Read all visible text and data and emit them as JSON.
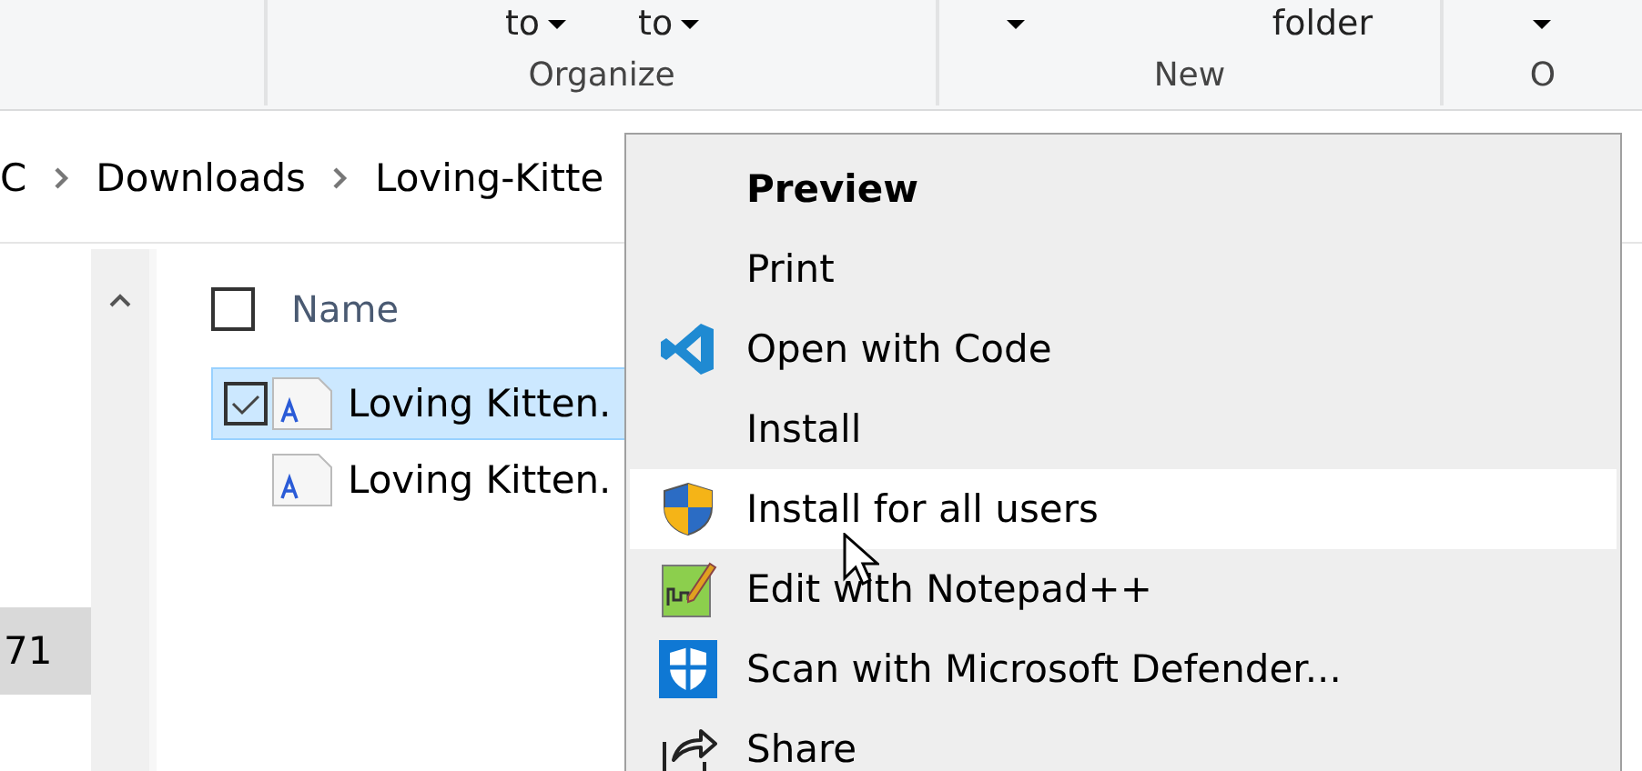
{
  "ribbon": {
    "buttons": [
      {
        "label": "to",
        "dropdown": true
      },
      {
        "label": "to",
        "dropdown": true
      },
      {
        "dropdown": true
      },
      {
        "label": "folder",
        "dropdown": false
      },
      {
        "dropdown": true
      }
    ],
    "groups": [
      "Organize",
      "New",
      "O"
    ]
  },
  "breadcrumb": [
    "C",
    "Downloads",
    "Loving-Kitte"
  ],
  "nav_pane": {
    "items": [
      {
        "label": "71",
        "selected": true
      }
    ]
  },
  "file_list": {
    "header": {
      "label": "Name",
      "checked": false
    },
    "rows": [
      {
        "name": "Loving Kitten.",
        "checked": true,
        "selected": true
      },
      {
        "name": "Loving Kitten.",
        "checked": false,
        "selected": false
      }
    ]
  },
  "context_menu": {
    "items": [
      {
        "label": "Preview",
        "kind": "plain",
        "default": true,
        "hovered": false
      },
      {
        "label": "Print",
        "kind": "plain",
        "default": false,
        "hovered": false
      },
      {
        "label": "Open with Code",
        "kind": "code",
        "default": false,
        "hovered": false
      },
      {
        "label": "Install",
        "kind": "plain",
        "default": false,
        "hovered": false
      },
      {
        "label": "Install for all users",
        "kind": "shield",
        "default": false,
        "hovered": true
      },
      {
        "label": "Edit with Notepad++",
        "kind": "notepad",
        "default": false,
        "hovered": false
      },
      {
        "label": "Scan with Microsoft Defender...",
        "kind": "defender",
        "default": false,
        "hovered": false
      },
      {
        "label": "Share",
        "kind": "share",
        "default": false,
        "hovered": false
      }
    ]
  }
}
